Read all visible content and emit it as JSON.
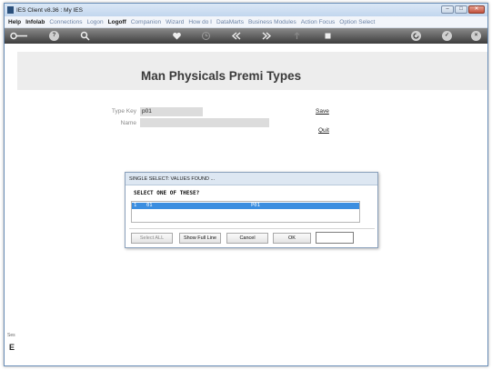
{
  "window": {
    "title": "IES Client v8.36 : My IES",
    "controls": {
      "minimize": "–",
      "maximize": "□",
      "close": "✕"
    }
  },
  "menu": [
    {
      "label": "Help",
      "strong": true
    },
    {
      "label": "Infolab",
      "strong": true
    },
    {
      "label": "Connections",
      "strong": false
    },
    {
      "label": "Logon",
      "strong": false
    },
    {
      "label": "Logoff",
      "strong": true
    },
    {
      "label": "Companion",
      "strong": false
    },
    {
      "label": "Wizard",
      "strong": false
    },
    {
      "label": "How do I",
      "strong": false
    },
    {
      "label": "DataMarts",
      "strong": false
    },
    {
      "label": "Business Modules",
      "strong": false
    },
    {
      "label": "Action Focus",
      "strong": false
    },
    {
      "label": "Option Select",
      "strong": false
    }
  ],
  "toolbar": {
    "icons": [
      "key-icon",
      "help-icon",
      "search-icon",
      "heart-icon",
      "clock-icon",
      "rewind-icon",
      "fast-forward-icon",
      "upload-icon",
      "stop-icon",
      "refresh-icon",
      "check-icon",
      "close-icon"
    ],
    "glyphs": {
      "help": "?",
      "close": "×",
      "check": "✓"
    }
  },
  "form": {
    "title": "Man Physicals Premi Types",
    "type_key_label": "Type Key",
    "type_key_value": "p01",
    "name_label": "Name",
    "name_value": "",
    "save_label": "Save",
    "quit_label": "Quit"
  },
  "dialog": {
    "title": "SINGLE SELECT: VALUES FOUND ...",
    "prompt": "SELECT ONE OF THESE?",
    "rows": [
      {
        "num": "1",
        "code": "01",
        "desc": "P01",
        "selected": true
      }
    ],
    "buttons": {
      "select_all": "Select ALL",
      "show_full_line": "Show Full Line",
      "cancel": "Cancel",
      "ok": "OK"
    }
  },
  "sidebar": {
    "text": "Ses",
    "icon_glyph": "E"
  },
  "colors": {
    "selection": "#3b8ee0",
    "toolbar": "#3e3e3e",
    "header_band": "#ededed"
  }
}
